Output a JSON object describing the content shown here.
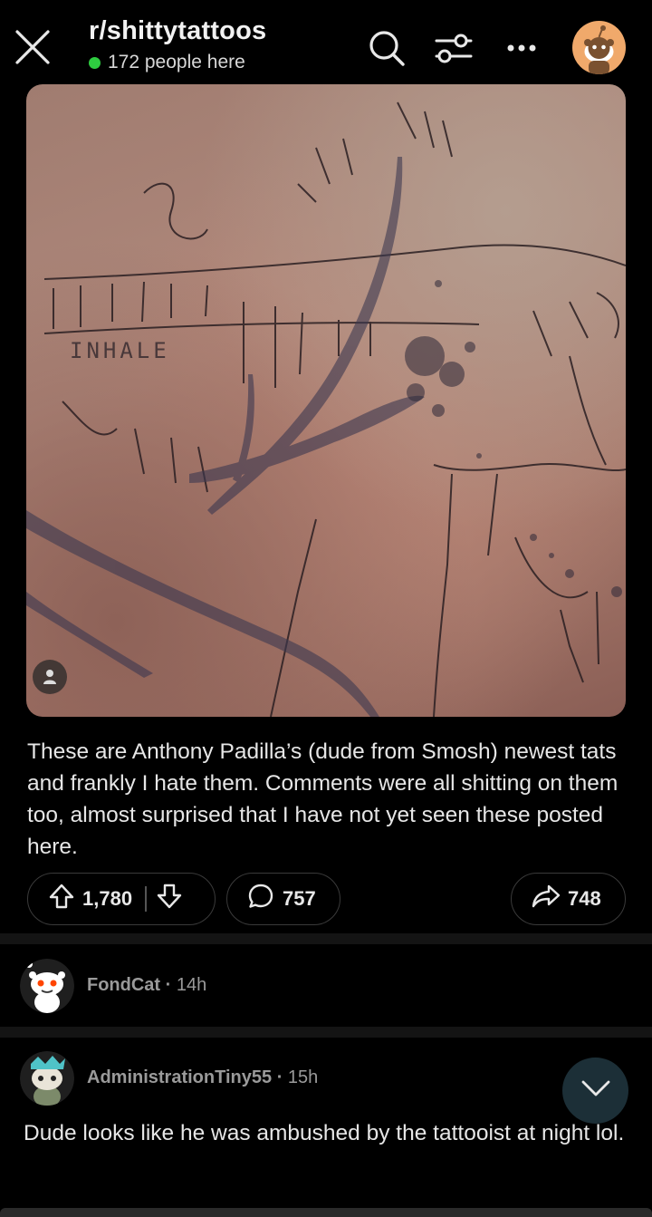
{
  "header": {
    "subreddit": "r/shittytattoos",
    "online_count": "172 people here",
    "icons": [
      "close-icon",
      "search-icon",
      "filter-icon",
      "more-icon",
      "avatar"
    ]
  },
  "post": {
    "image_text": "INHALE",
    "body": "These are Anthony Padilla’s (dude from Smosh) newest tats and frankly I hate them. Comments were all shitting on them too, almost surprised that I have not yet seen these posted here.",
    "upvotes": "1,780",
    "comments": "757",
    "shares": "748"
  },
  "comments": [
    {
      "author": "FondCat",
      "separator": "·",
      "time": "14h",
      "body": ""
    },
    {
      "author": "AdministrationTiny55",
      "separator": "·",
      "time": "15h",
      "body": "Dude looks like he was ambushed by the tattooist at night lol."
    }
  ],
  "colors": {
    "background": "#000000",
    "online_dot": "#2ecc40",
    "avatar_orange": "#f0a96b",
    "fab": "#1c2f37"
  }
}
